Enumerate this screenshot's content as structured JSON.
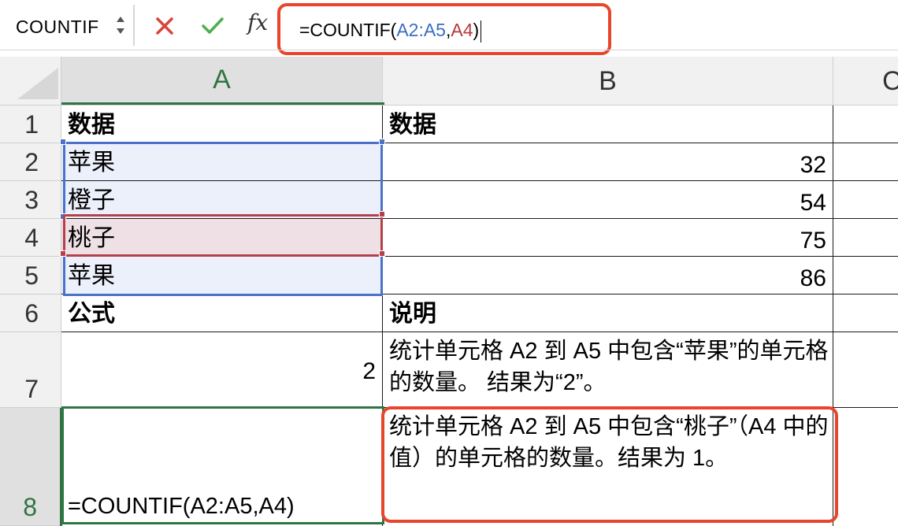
{
  "formula_bar": {
    "name_box": "COUNTIF",
    "fx_label": "fx",
    "formula": {
      "prefix": "=COUNTIF(",
      "range": "A2:A5",
      "sep": ",",
      "criteria": "A4",
      "suffix": ")"
    }
  },
  "columns": [
    "A",
    "B",
    "C"
  ],
  "rows": [
    "1",
    "2",
    "3",
    "4",
    "5",
    "6",
    "7",
    "8"
  ],
  "cells": {
    "A1": "数据",
    "B1": "数据",
    "A2": "苹果",
    "B2": "32",
    "A3": "橙子",
    "B3": "54",
    "A4": "桃子",
    "B4": "75",
    "A5": "苹果",
    "B5": "86",
    "A6": "公式",
    "B6": "说明",
    "A7": "2",
    "B7": "统计单元格 A2 到 A5 中包含“苹果”的单元格的数量。 结果为“2”。",
    "A8": "=COUNTIF(A2:A5,A4)",
    "B8": "统计单元格 A2 到 A5 中包含“桃子”（A4 中的值）的单元格的数量。结果为 1。"
  },
  "colors": {
    "selection_green": "#2f7443",
    "range_blue": "#4a72c8",
    "range_red": "#b5404a",
    "callout_red": "#e8452c"
  }
}
